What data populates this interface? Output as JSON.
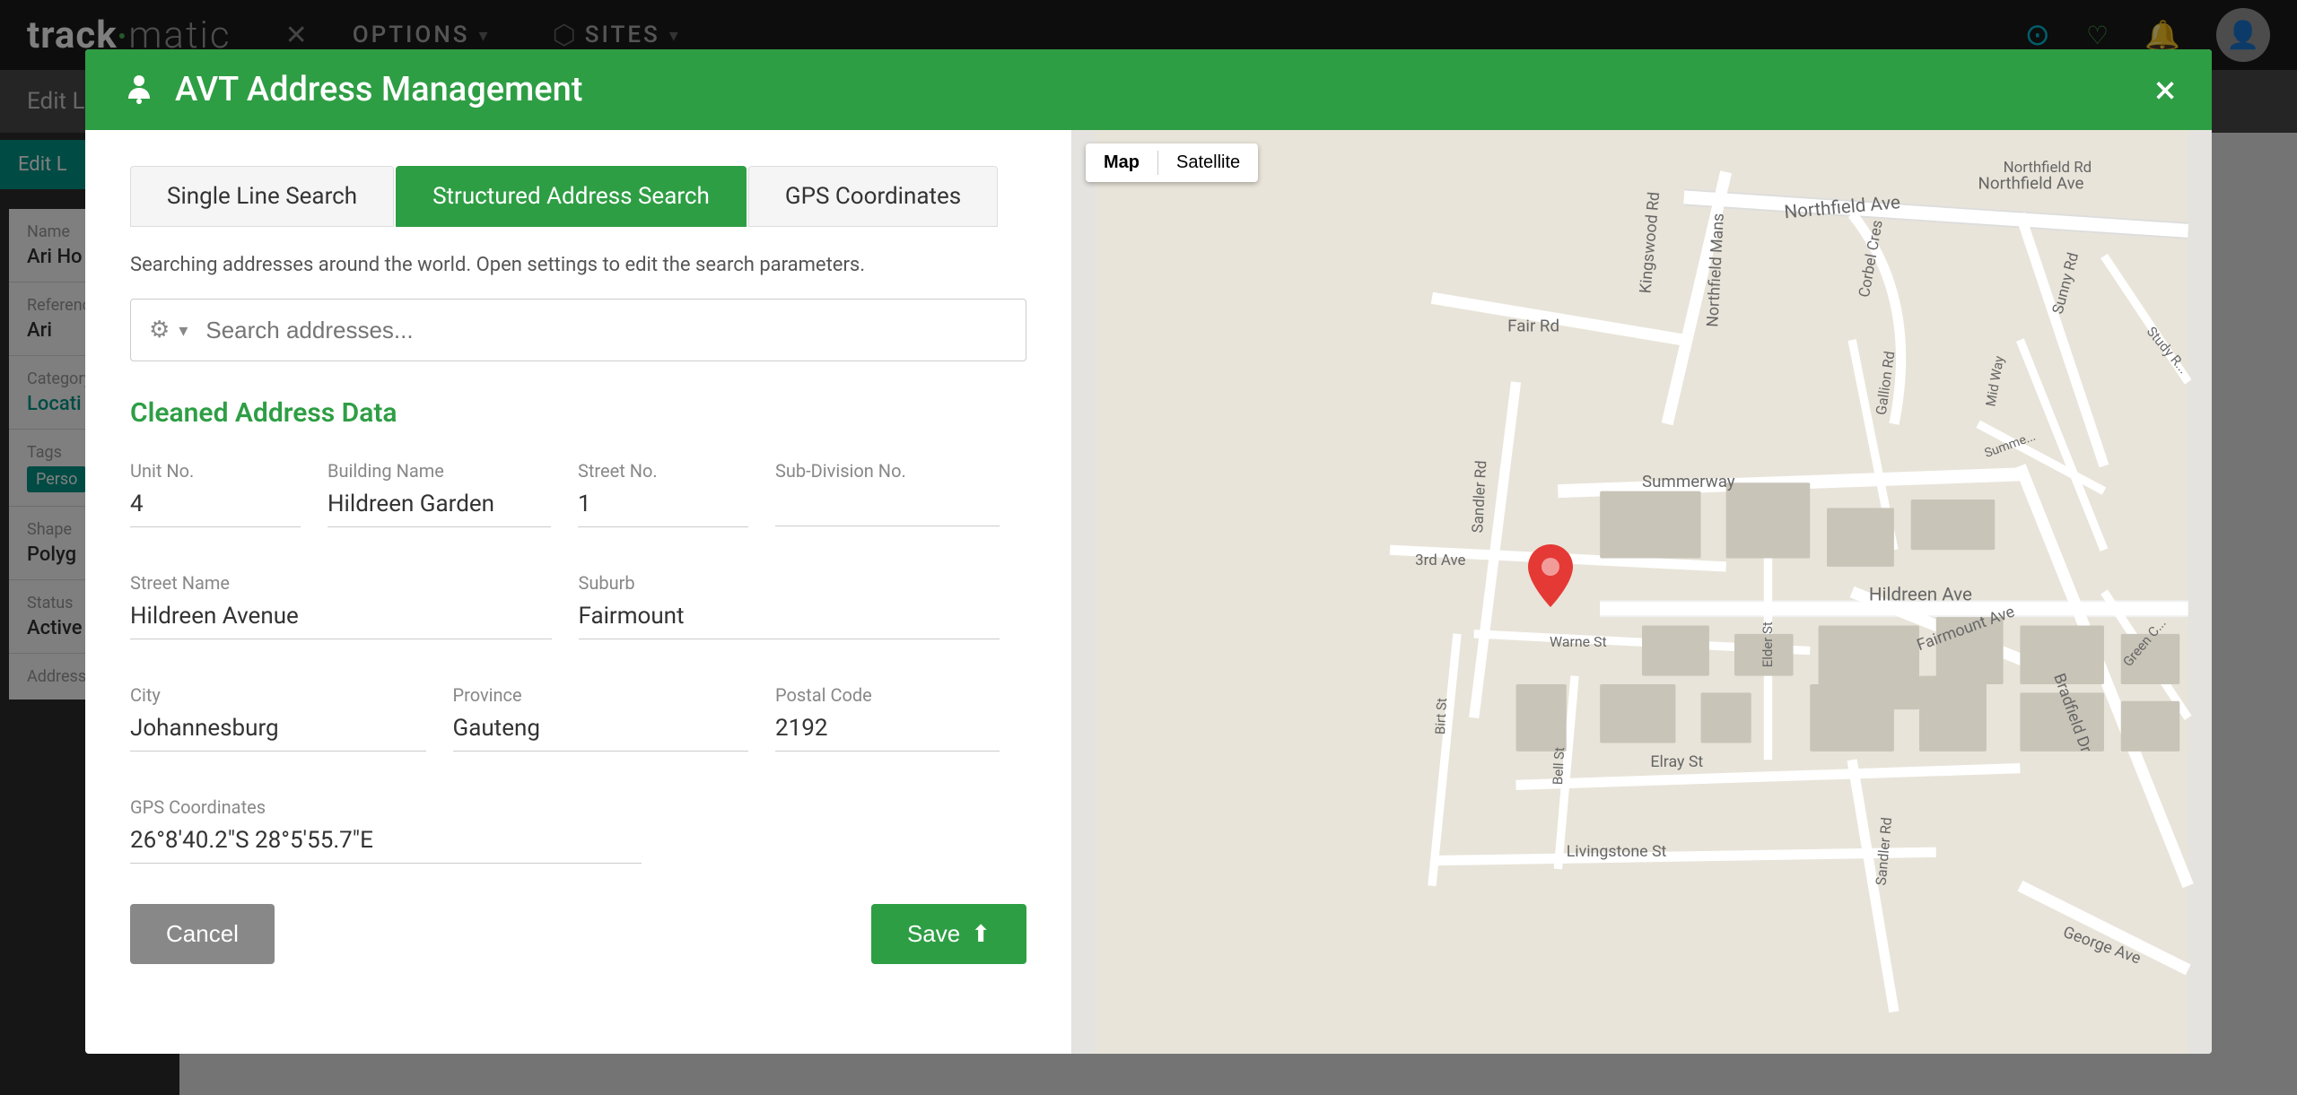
{
  "app": {
    "brand_track": "track",
    "brand_matic": "matic",
    "nav_menu": [
      {
        "label": "OPTIONS",
        "id": "options"
      },
      {
        "label": "SITES",
        "id": "sites"
      }
    ]
  },
  "modal": {
    "title": "AVT Address Management",
    "close_label": "×",
    "tabs": [
      {
        "id": "single",
        "label": "Single Line Search",
        "active": false
      },
      {
        "id": "structured",
        "label": "Structured Address Search",
        "active": true
      },
      {
        "id": "gps",
        "label": "GPS Coordinates",
        "active": false
      }
    ],
    "search_info": "Searching addresses around the world. Open settings to edit the search parameters.",
    "search_placeholder": "Search addresses...",
    "section_title": "Cleaned Address Data",
    "fields": {
      "unit_no_label": "Unit No.",
      "unit_no_value": "4",
      "building_name_label": "Building Name",
      "building_name_value": "Hildreen Garden",
      "street_no_label": "Street No.",
      "street_no_value": "1",
      "subdivision_label": "Sub-Division No.",
      "subdivision_value": "",
      "street_name_label": "Street Name",
      "street_name_value": "Hildreen Avenue",
      "suburb_label": "Suburb",
      "suburb_value": "Fairmount",
      "city_label": "City",
      "city_value": "Johannesburg",
      "province_label": "Province",
      "province_value": "Gauteng",
      "postal_code_label": "Postal Code",
      "postal_code_value": "2192",
      "gps_label": "GPS Coordinates",
      "gps_value": "26°8'40.2\"S 28°5'55.7\"E"
    },
    "cancel_label": "Cancel",
    "save_label": "Save",
    "map_type_map": "Map",
    "map_type_satellite": "Satellite"
  },
  "bg_page": {
    "edit_bar_text": "Edit L",
    "edit_label": "Edit L",
    "fields": [
      {
        "label": "Name",
        "value": "Ari Ho"
      },
      {
        "label": "Reference",
        "value": "Ari"
      },
      {
        "label": "Category",
        "value": "Locati"
      },
      {
        "label": "Tags",
        "value": "Perso"
      },
      {
        "label": "Shape",
        "value": "Polyg"
      },
      {
        "label": "Status",
        "value": "Active"
      },
      {
        "label": "Address",
        "value": ""
      }
    ]
  },
  "colors": {
    "green": "#2e9e44",
    "dark": "#1a1a1a",
    "teal": "#009688",
    "accent_cyan": "#00bcd4"
  }
}
